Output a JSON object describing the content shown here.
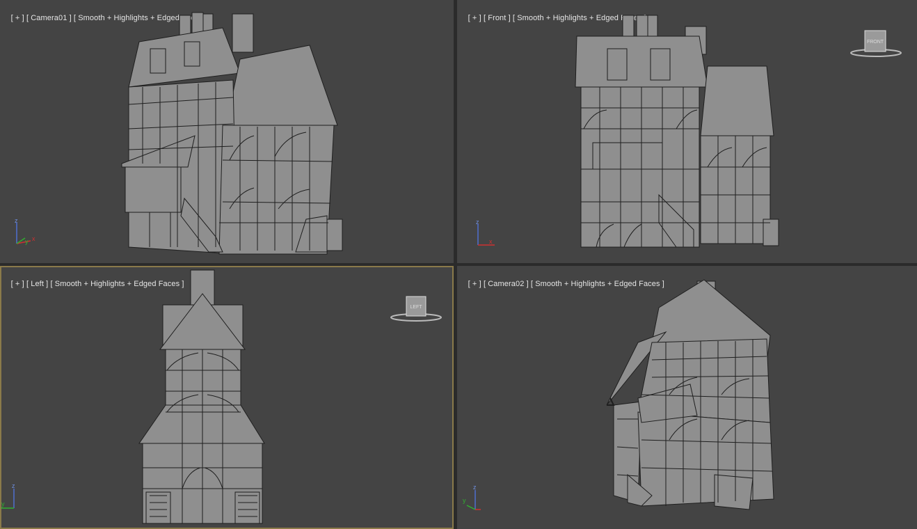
{
  "viewports": [
    {
      "plus": "[ + ]",
      "view": "[ Camera01 ]",
      "shading": "[ Smooth + Highlights + Edged Faces ]"
    },
    {
      "plus": "[ + ]",
      "view": "[ Front ]",
      "shading": "[ Smooth + Highlights + Edged Faces ]",
      "viewcube": "FRONT"
    },
    {
      "plus": "[ + ]",
      "view": "[ Left ]",
      "shading": "[ Smooth + Highlights + Edged Faces ]",
      "viewcube": "LEFT"
    },
    {
      "plus": "[ + ]",
      "view": "[ Camera02 ]",
      "shading": "[ Smooth + Highlights + Edged Faces ]"
    }
  ],
  "axis_labels": {
    "z": "z",
    "x": "x",
    "y": "y"
  },
  "colors": {
    "viewport_bg": "#444444",
    "active_border": "#8a7a4a",
    "model_fill": "#8f8f8f",
    "edge": "#1e1e1e",
    "axis_x": "#d03030",
    "axis_y": "#30b030",
    "axis_z": "#4f6fd0"
  },
  "active_viewport": "Left"
}
